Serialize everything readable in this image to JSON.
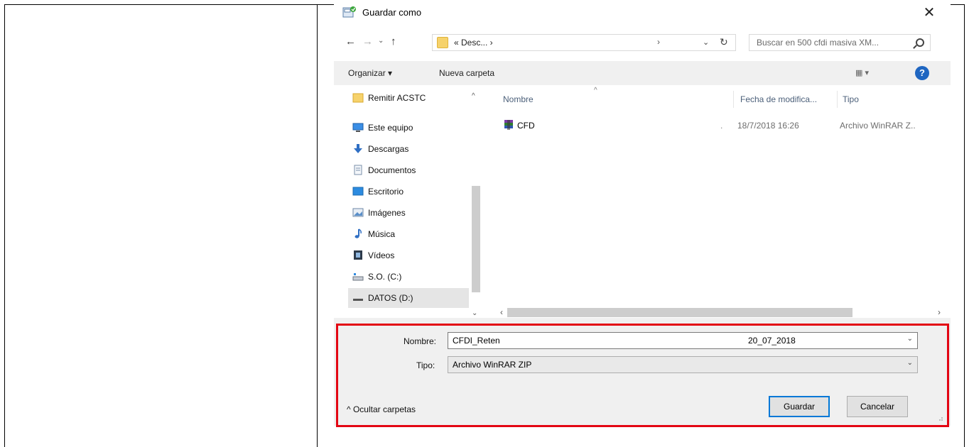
{
  "dialog": {
    "title": "Guardar como",
    "close_glyph": "✕"
  },
  "nav": {
    "back_glyph": "←",
    "forward_glyph": "→",
    "recent_glyph": "⌄",
    "up_glyph": "↑",
    "address_text": "« Desc... ›",
    "address_chevron": "›",
    "address_dropdown": "⌄",
    "refresh_glyph": "↻",
    "search_placeholder": "Buscar en 500 cfdi masiva XM..."
  },
  "toolbar": {
    "organize": "Organizar ▾",
    "new_folder": "Nueva carpeta",
    "view": "▦ ▾",
    "help": "?"
  },
  "sidebar": {
    "items": [
      {
        "label": "Remitir ACSTC",
        "icon": "folder-icon"
      },
      {
        "label": "Este equipo",
        "icon": "computer-icon"
      },
      {
        "label": "Descargas",
        "icon": "download-icon"
      },
      {
        "label": "Documentos",
        "icon": "document-icon"
      },
      {
        "label": "Escritorio",
        "icon": "desktop-icon"
      },
      {
        "label": "Imágenes",
        "icon": "pictures-icon"
      },
      {
        "label": "Música",
        "icon": "music-icon"
      },
      {
        "label": "Vídeos",
        "icon": "videos-icon"
      },
      {
        "label": "S.O. (C:)",
        "icon": "drive-c-icon"
      },
      {
        "label": "DATOS (D:)",
        "icon": "drive-d-icon"
      }
    ]
  },
  "files": {
    "columns": [
      "Nombre",
      "Fecha de modifica...",
      "Tipo"
    ],
    "rows": [
      {
        "name": "CFD",
        "date": "18/7/2018 16:26",
        "type": "Archivo WinRAR Z..",
        "icon": "winrar-archive-icon"
      }
    ]
  },
  "form": {
    "name_label": "Nombre:",
    "name_value": "CFDI_Reten",
    "name_value_suffix": "20_07_2018",
    "type_label": "Tipo:",
    "type_value": "Archivo WinRAR ZIP",
    "save_button": "Guardar",
    "cancel_button": "Cancelar",
    "hide_folders": "^  Ocultar carpetas"
  },
  "colors": {
    "highlight": "#e30613",
    "accent": "#0078d7",
    "help": "#1f66c1"
  }
}
